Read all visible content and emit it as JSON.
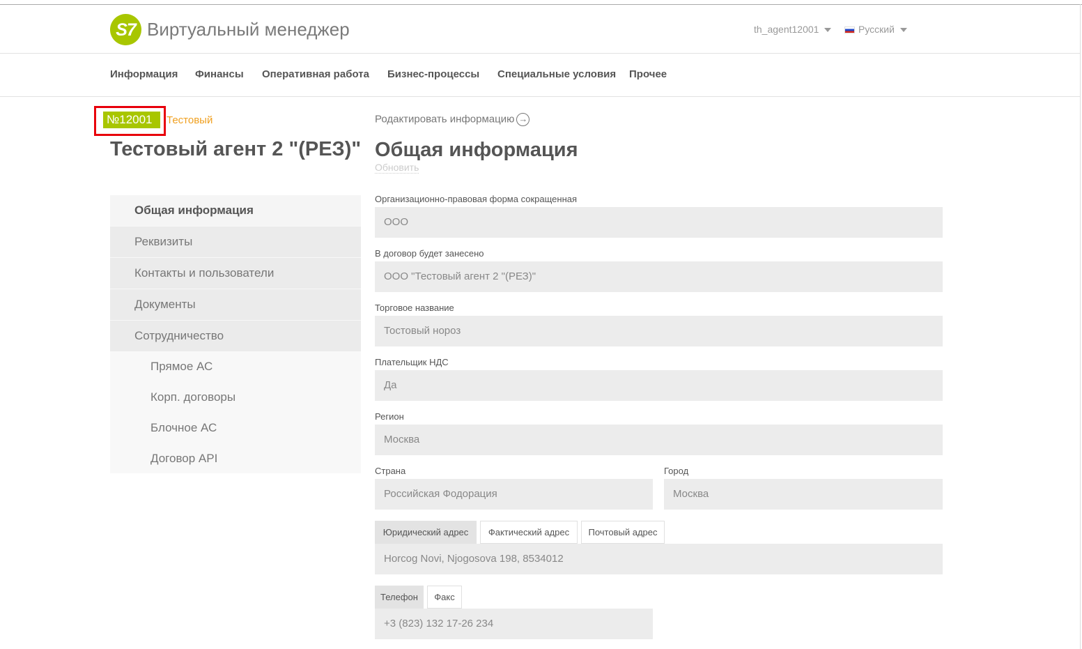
{
  "header": {
    "logo_text": "S7",
    "brand": "Виртуальный менеджер",
    "user": "th_agent12001",
    "language": "Русский"
  },
  "nav": [
    "Информация",
    "Финансы",
    "Оперативная работа",
    "Бизнес-процессы",
    "Специальные условия",
    "Прочее"
  ],
  "agent": {
    "number": "№12001",
    "tag": "Тестовый",
    "title": "Тестовый агент 2 \"(РЕЗ)\""
  },
  "sidebar": {
    "items": [
      "Общая информация",
      "Реквизиты",
      "Контакты и пользователи",
      "Документы",
      "Сотрудничество"
    ],
    "subitems": [
      "Прямое АС",
      "Корп. договоры",
      "Блочное АС",
      "Договор API"
    ]
  },
  "main": {
    "edit_link": "Родактировать информацию",
    "title": "Общая информация",
    "refresh": "Обновить",
    "fields": {
      "org_form": {
        "label": "Организационно-правовая форма сокращенная",
        "value": "ООО"
      },
      "contract_name": {
        "label": "В договор будет занесено",
        "value": "ООО \"Тестовый агент 2 \"(РЕЗ)\""
      },
      "trade_name": {
        "label": "Торговое название",
        "value": "Тостовый нороз"
      },
      "vat": {
        "label": "Плательщик НДС",
        "value": "Да"
      },
      "region": {
        "label": "Регион",
        "value": "Москва"
      },
      "country": {
        "label": "Страна",
        "value": "Российская Фодорация"
      },
      "city": {
        "label": "Город",
        "value": "Москва"
      }
    },
    "address_tabs": [
      "Юридический адрес",
      "Фактический адрес",
      "Почтовый адрес"
    ],
    "address_value": "Horcog Novi, Njogosova 198, 8534012",
    "phone_tabs": [
      "Телефон",
      "Факс"
    ],
    "phone_value": "+3 (823) 132 17-26 234"
  },
  "colors": {
    "accent": "#a8c600",
    "highlight": "#e8000b",
    "tag": "#f0a020"
  }
}
